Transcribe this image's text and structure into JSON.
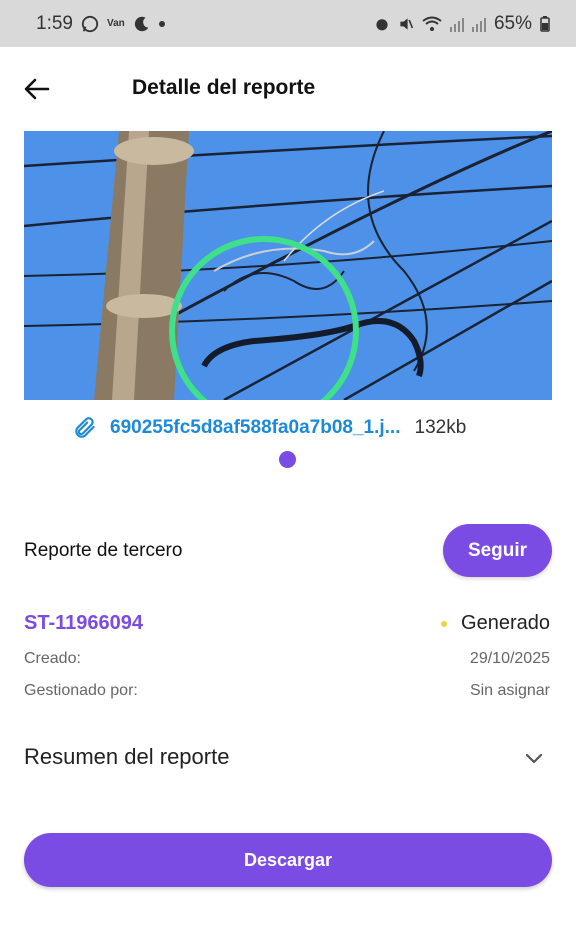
{
  "status_bar": {
    "time": "1:59",
    "carrier_icon_text": "Van",
    "battery": "65%"
  },
  "header": {
    "title": "Detalle del reporte"
  },
  "attachment": {
    "file_name": "690255fc5d8af588fa0a7b08_1.j...",
    "file_size": "132kb"
  },
  "report": {
    "type": "Reporte de tercero",
    "follow_label": "Seguir",
    "ticket_id": "ST-11966094",
    "status": "Generado",
    "created_label": "Creado:",
    "created_value": "29/10/2025",
    "managed_label": "Gestionado por:",
    "managed_value": "Sin asignar",
    "summary_label": "Resumen del reporte"
  },
  "actions": {
    "download_label": "Descargar"
  },
  "colors": {
    "accent": "#7a4ce3",
    "link": "#1c8ad6",
    "status_dot": "#f0d24a"
  }
}
